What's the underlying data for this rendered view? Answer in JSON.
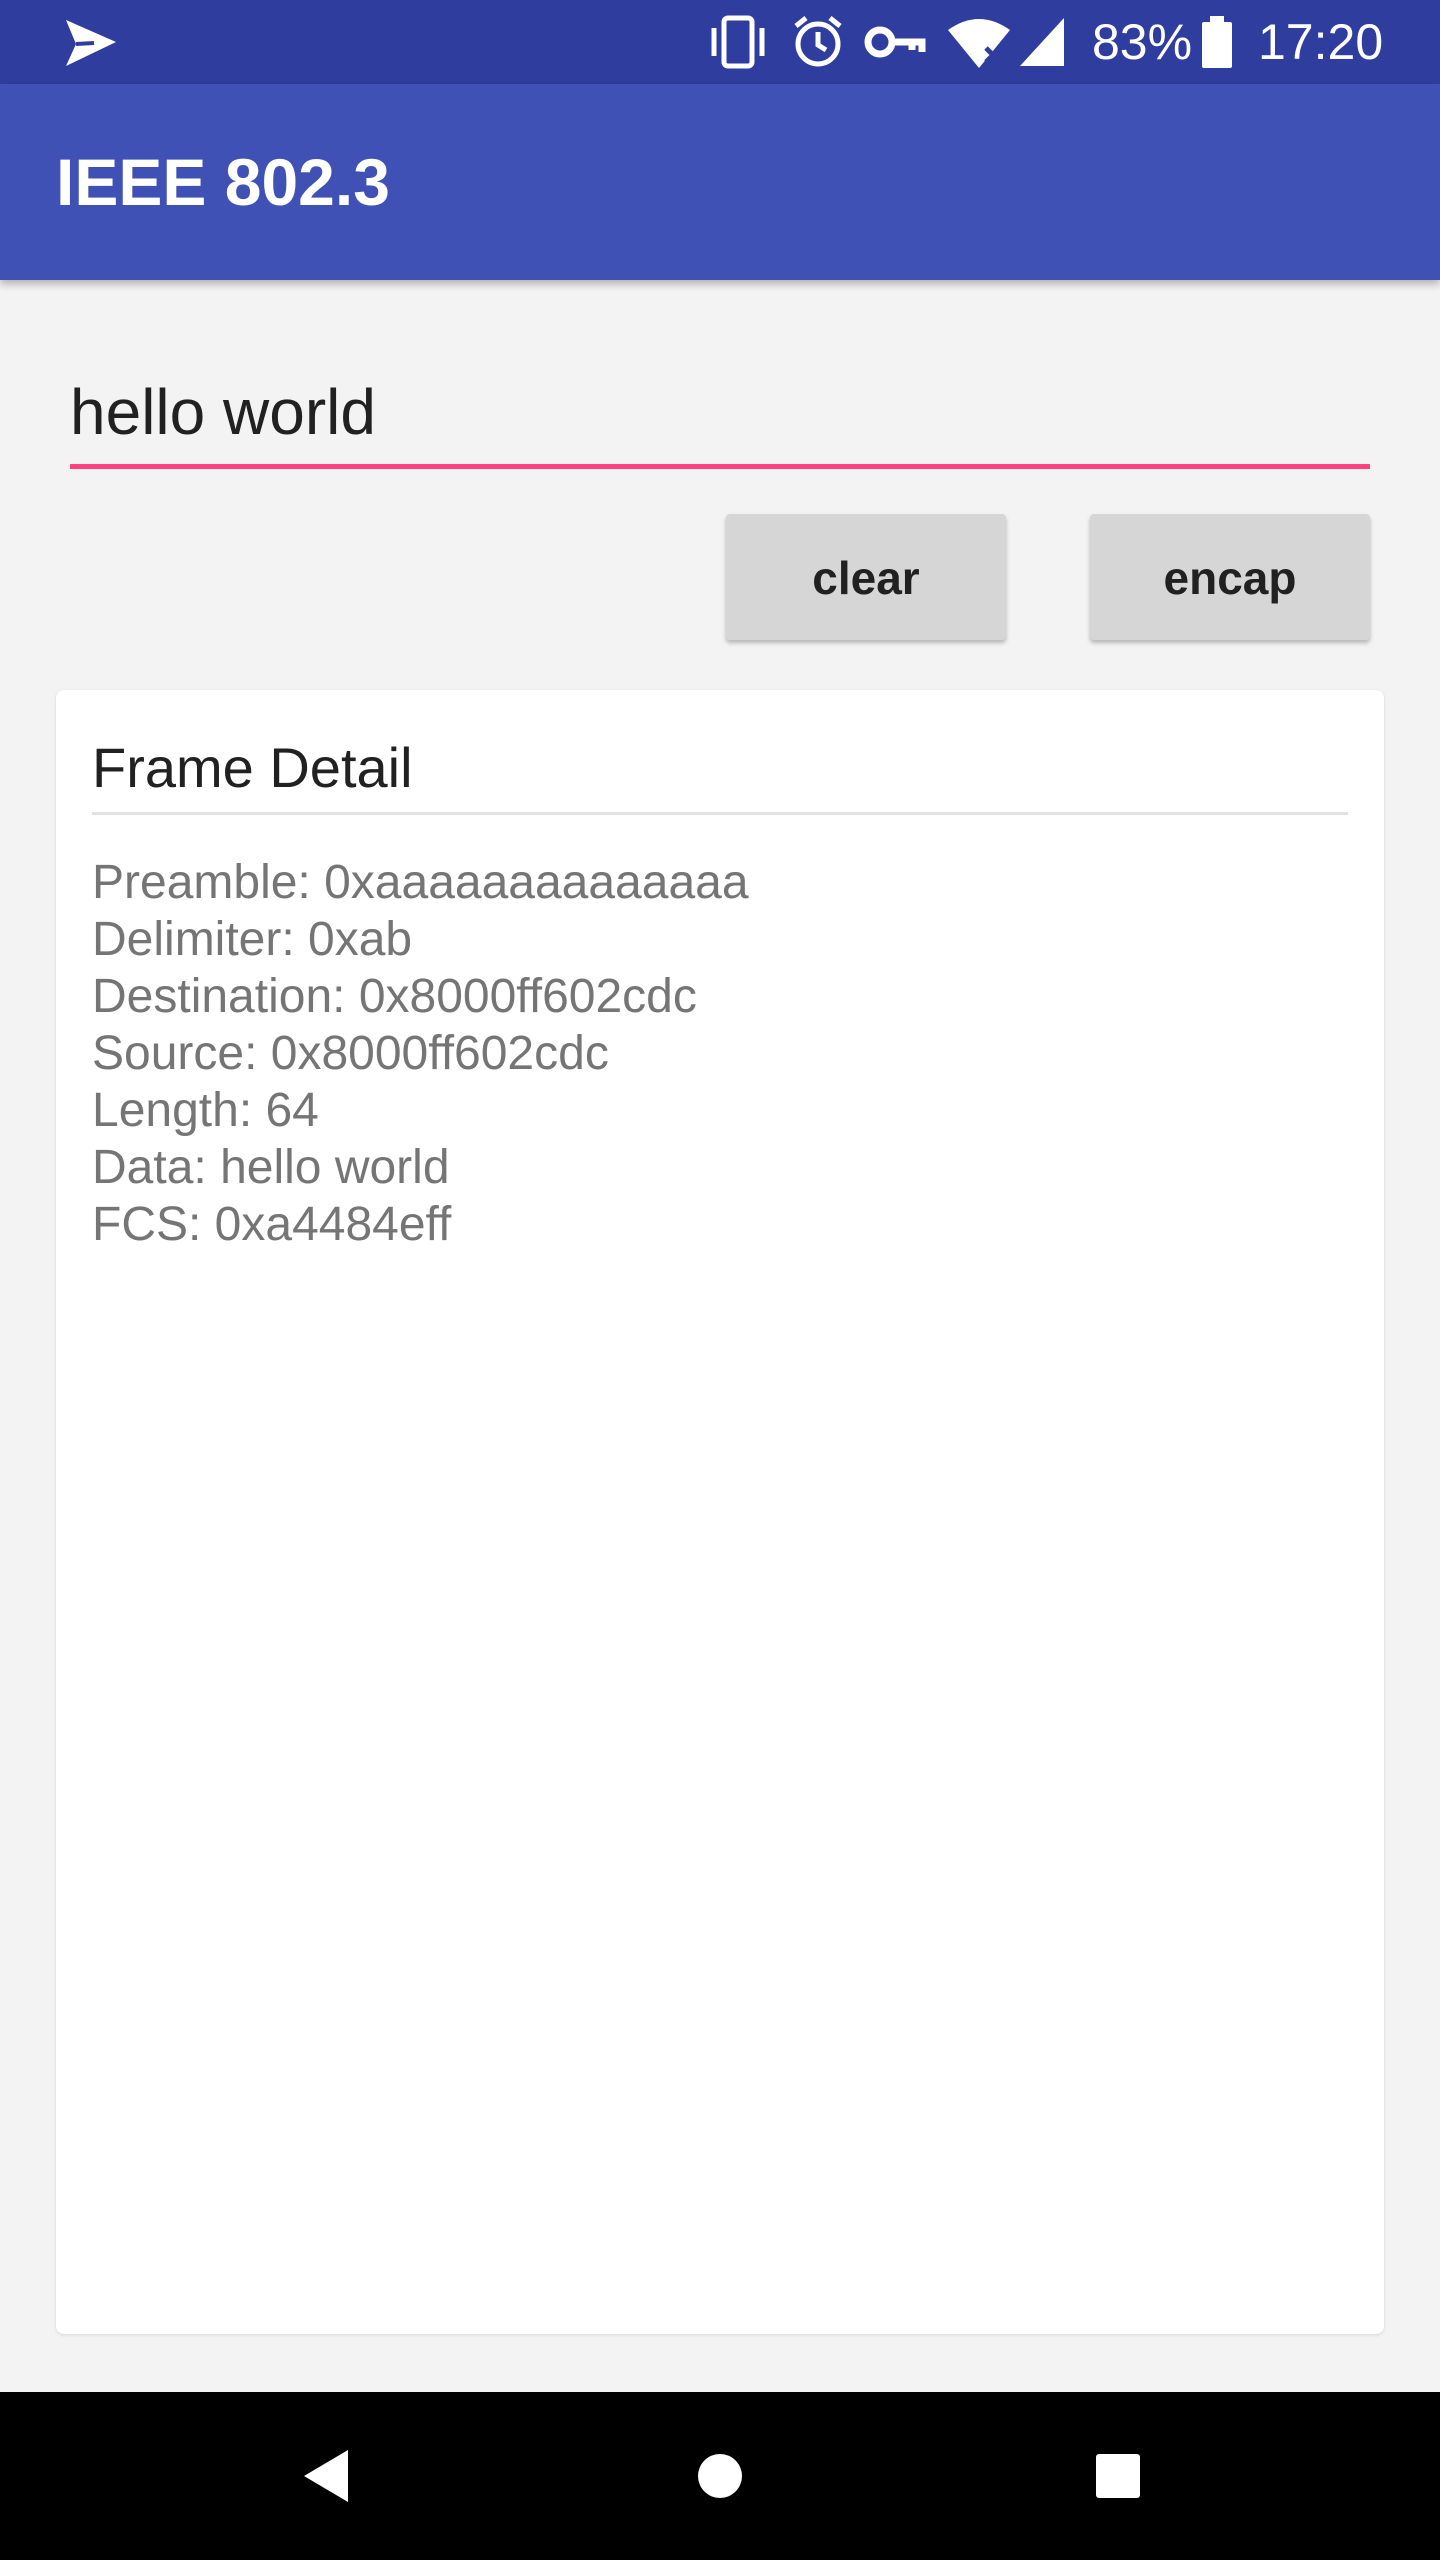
{
  "status_bar": {
    "battery": "83%",
    "time": "17:20",
    "icons": [
      "send-icon",
      "vibrate-icon",
      "alarm-icon",
      "vpn-key-icon",
      "wifi-icon",
      "signal-icon",
      "battery-icon"
    ]
  },
  "app_bar": {
    "title": "IEEE 802.3"
  },
  "input": {
    "value": "hello world"
  },
  "buttons": {
    "clear": "clear",
    "encap": "encap"
  },
  "frame_detail": {
    "title": "Frame Detail",
    "lines": [
      "Preamble: 0xaaaaaaaaaaaaaa",
      "Delimiter: 0xab",
      "Destination: 0x8000ff602cdc",
      "Source: 0x8000ff602cdc",
      "Length: 64",
      "Data: hello world",
      "FCS: 0xa4484eff"
    ]
  },
  "nav_bar": {
    "icons": [
      "back-icon",
      "home-icon",
      "recents-icon"
    ]
  },
  "colors": {
    "status_bar": "#2f3e9e",
    "app_bar": "#3f51b5",
    "accent": "#ff4081",
    "button": "#d6d6d6",
    "background": "#f3f3f3"
  }
}
